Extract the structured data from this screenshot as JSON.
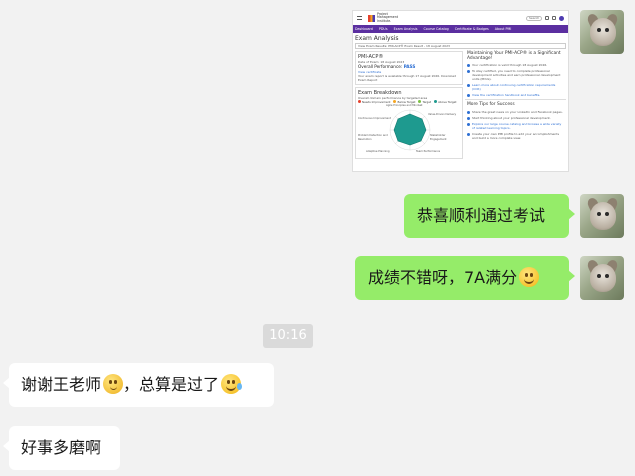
{
  "messages": [
    {
      "side": "right",
      "type": "image",
      "label": "PMI exam analysis screenshot"
    },
    {
      "side": "right",
      "type": "text",
      "text": "恭喜顺利通过考试"
    },
    {
      "side": "right",
      "type": "text",
      "text": "成绩不错呀，7A满分",
      "emoji": "smile-emoji"
    },
    {
      "side": "center",
      "type": "time",
      "text": "10:16"
    },
    {
      "side": "left",
      "type": "text",
      "text_a": "谢谢王老师",
      "emoji_a": "thinking-emoji",
      "text_b": "，总算是过了",
      "emoji_b": "tears-of-joy-emoji"
    },
    {
      "side": "left",
      "type": "text",
      "text": "好事多磨啊"
    }
  ],
  "screenshot": {
    "brand": "Project Management Institute.",
    "search_label": "Search",
    "nav": [
      "Dashboard",
      "PDUs",
      "Exam Analysis",
      "Course Catalog",
      "Certificate & Badges",
      "About PMI"
    ],
    "page_title": "Exam Analysis",
    "filter_label": "View Exam Results: PMI-ACP® Exam Result - 18 August 2023",
    "cert": {
      "name": "PMI-ACP®",
      "date": "Date of Exam: 18 August 2023",
      "overall_label": "Overall Performance:",
      "overall_value": "PASS",
      "link": "View certificate",
      "note": "Your exam report is available through 17 August 2026. Download Exam Report"
    },
    "breakdown": {
      "title": "Exam Breakdown",
      "subtitle": "Overall domain performance by targeted area",
      "legend": [
        "Needs Improvement",
        "Below Target",
        "Target",
        "Above Target"
      ],
      "axes": [
        "Agile Principles and Mindset",
        "Value-Driven Delivery",
        "Stakeholder Engagement",
        "Team Performance",
        "Adaptive Planning",
        "Problem Detection and Resolution",
        "Continuous Improvement"
      ]
    },
    "promo": {
      "title": "Maintaining Your PMI-ACP® is a Significant Advantage!",
      "items": [
        "Your certification is valid through 18 August 2026.",
        "To stay certified, you need to complete professional development activities and earn professional development units (PDUs).",
        "Learn more about continuing certification requirements (CCR)"
      ],
      "link": "View the certification handbook and benefits."
    },
    "tips": {
      "title": "More Tips for Success",
      "items": [
        "Share the great news on your LinkedIn and Facebook pages.",
        "Start thinking about your professional development.",
        "Explore our large course catalog and browse a wide variety of related learning topics.",
        "Create your own PMI profile to add your accomplishments and build a more complete view."
      ]
    }
  },
  "colors": {
    "bubble_green": "#95ec69",
    "bubble_white": "#ffffff",
    "background": "#f2f2f2",
    "nav_purple": "#5b2fa0",
    "radar_teal": "#1e9a8f"
  }
}
